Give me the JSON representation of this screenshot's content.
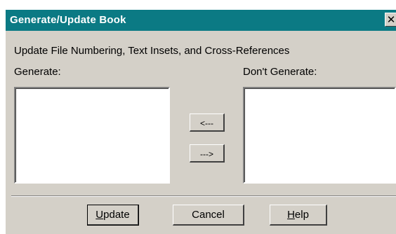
{
  "window": {
    "title": "Generate/Update Book",
    "close_glyph": "✕"
  },
  "dialog": {
    "description": "Update File Numbering, Text Insets,  and Cross-References",
    "generate_label": "Generate:",
    "dont_generate_label": "Don't Generate:",
    "move_left_label": "<---",
    "move_right_label": "--->",
    "generate_items": [],
    "dont_generate_items": []
  },
  "buttons": {
    "update": {
      "mnemonic": "U",
      "rest": "pdate"
    },
    "cancel": "Cancel",
    "help": {
      "mnemonic": "H",
      "rest": "elp"
    }
  }
}
